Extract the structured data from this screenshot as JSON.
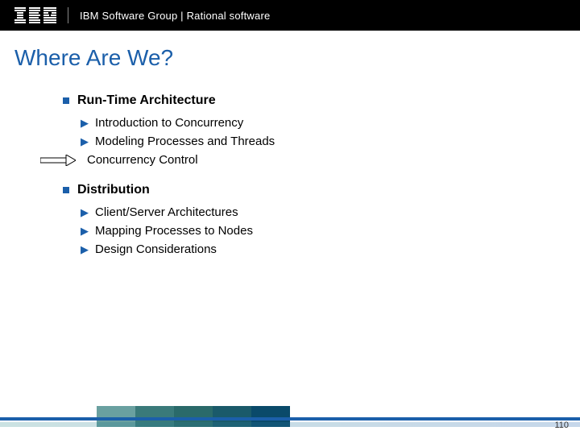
{
  "header": {
    "logo_alt": "IBM",
    "text": "IBM Software Group | Rational software"
  },
  "title": "Where Are We?",
  "sections": [
    {
      "heading": "Run-Time Architecture",
      "items": [
        {
          "label": "Introduction to Concurrency",
          "current": false
        },
        {
          "label": "Modeling Processes and Threads",
          "current": false
        },
        {
          "label": "Concurrency Control",
          "current": true
        }
      ]
    },
    {
      "heading": "Distribution",
      "items": [
        {
          "label": "Client/Server Architectures",
          "current": false
        },
        {
          "label": "Mapping Processes to Nodes",
          "current": false
        },
        {
          "label": "Design Considerations",
          "current": false
        }
      ]
    }
  ],
  "page_number": "110"
}
